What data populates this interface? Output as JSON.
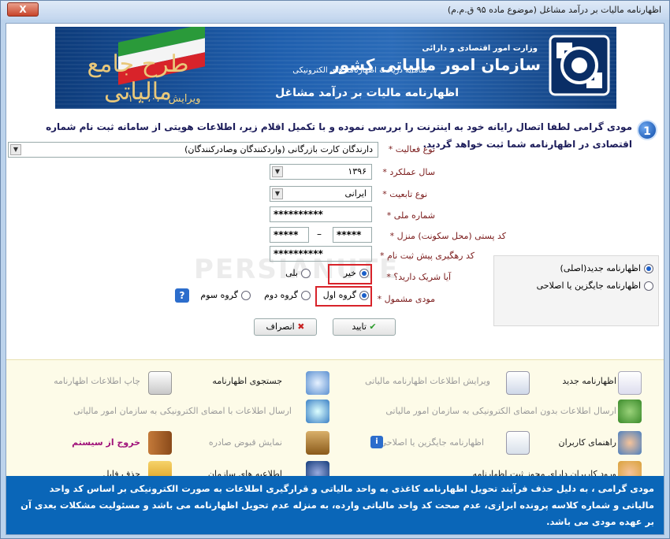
{
  "window": {
    "title": "اظهارنامه مالیات بر درآمد مشاغل (موضوع ماده ۹۵ ق.م.م)",
    "close_label": "X"
  },
  "banner": {
    "ministry": "وزارت امور اقتصادی و دارائی",
    "org": "سازمان امور مالیاتی کشور",
    "system": "سامانه دریافت اظهارنامه های الکترونیکی",
    "form_title": "اظهارنامه مالیات بر درآمد مشاغل",
    "logo_text": "طرح جامع مالیاتی",
    "version": "ویرایش ۱۰،۰،۰،۰"
  },
  "step_number": "1",
  "instruction": "مودی گرامی لطفا اتصال رایانه خود به اینترنت را بررسی نموده و با تکمیل اقلام زیر، اطلاعات هویتی از سامانه ثبت نام شماره اقتصادی در اظهارنامه شما ثبت خواهد گردید.",
  "form": {
    "activity_label": "نوع فعالیت *",
    "activity_value": "دارندگان کارت بازرگانی (واردکنندگان وصادرکنندگان)",
    "year_label": "سال عملکرد *",
    "year_value": "۱۳۹۶",
    "nationality_label": "نوع تابعیت *",
    "nationality_value": "ایرانی",
    "national_id_label": "شماره ملی *",
    "national_id_value": "**********",
    "postal_label": "کد پستی (محل سکونت) منزل *",
    "postal_part1": "*****",
    "postal_part2": "*****",
    "postal_dash": "–",
    "tracking_label": "کد رهگیری پیش ثبت نام *",
    "tracking_value": "**********",
    "partner_label": "آیا شریک دارید؟ *",
    "partner_no": "خیر",
    "partner_yes": "بلی",
    "taxpayer_label": "مودی مشمول *",
    "group1": "گروه اول",
    "group2": "گروه دوم",
    "group3": "گروه سوم",
    "help": "?"
  },
  "side_panel": {
    "new_return": "اظهارنامه جدید(اصلی)",
    "replacement_return": "اظهارنامه جایگزین یا اصلاحی"
  },
  "buttons": {
    "confirm": "تایید",
    "cancel": "انصراف"
  },
  "watermark": "PERSIANUTE",
  "menu": {
    "new_return": "اظهارنامه جدید",
    "edit_info": "ویرایش اطلاعات اظهارنامه مالیاتی",
    "search": "جستجوی اظهارنامه",
    "print": "چاپ اطلاعات اظهارنامه",
    "send_unsigned": "ارسال اطلاعات بدون امضای الکترونیکی به سازمان امور مالیاتی",
    "send_signed": "ارسال اطلاعات با امضای الکترونیکی به سازمان امور مالیاتی",
    "user_guide": "راهنمای کاربران",
    "replacement": "اظهارنامه جایگزین یا اصلاحی",
    "receipts": "نمایش قبوض صادره",
    "exit": "خروج از سیستم",
    "registered_users": "ورود کاربران دارای مجوز ثبت اظهارنامه",
    "org_news": "اطلاعیه های سازمان",
    "delete_file": "حذف فایل"
  },
  "footer": "مودی گرامی ، به دلیل حذف فرآیند تحویل اظهارنامه کاغذی به واحد مالیاتی و قرارگیری اطلاعات به صورت الکترونیکی بر اساس کد واحد مالیاتی و شماره کلاسه پرونده ابرازی، عدم صحت کد واحد مالیاتی وارده، به منزله عدم تحویل اظهارنامه می باشد و مسئولیت مشکلات بعدی آن بر عهده مودی می باشد.",
  "colors": {
    "banner_blue": "#1f5fae",
    "footer_blue": "#0a66b8",
    "highlight_red": "#d8232a",
    "label_red": "#7a1a1a"
  }
}
